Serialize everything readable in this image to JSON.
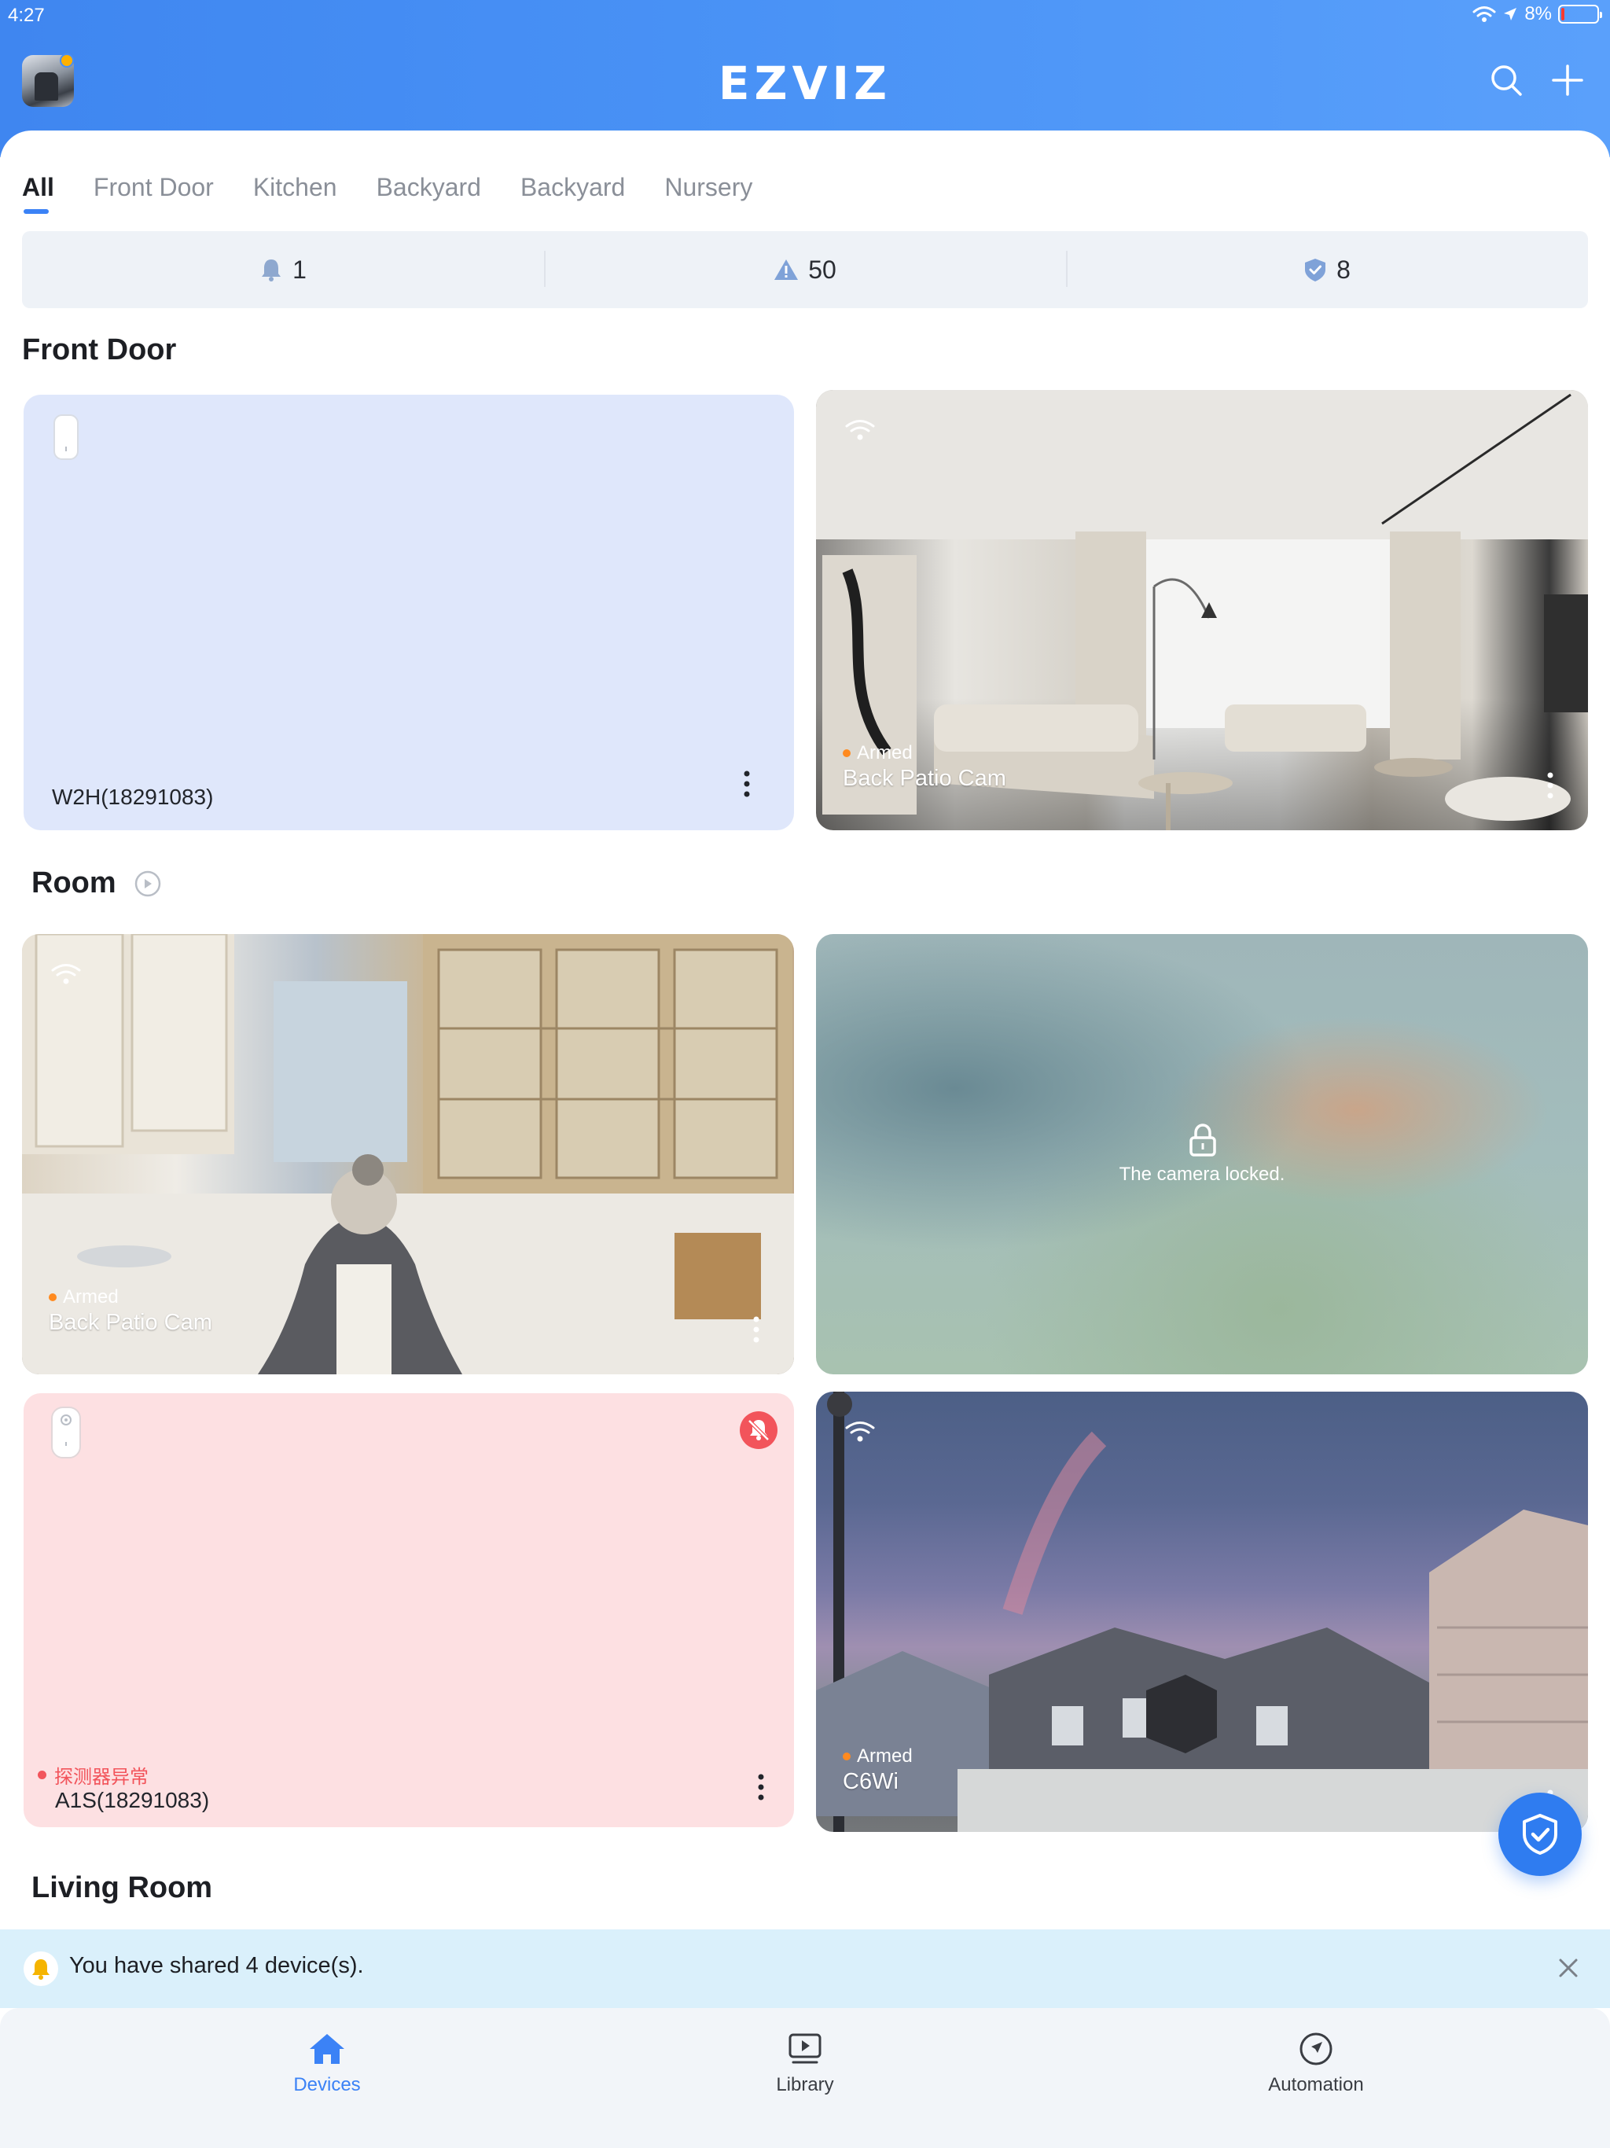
{
  "status_bar": {
    "time": "4:27",
    "battery": "8%"
  },
  "header": {
    "brand": "EZVIZ"
  },
  "tabs": [
    {
      "label": "All",
      "active": true
    },
    {
      "label": "Front Door",
      "active": false
    },
    {
      "label": "Kitchen",
      "active": false
    },
    {
      "label": "Backyard",
      "active": false
    },
    {
      "label": "Backyard",
      "active": false
    },
    {
      "label": "Nursery",
      "active": false
    }
  ],
  "summary": {
    "alerts": "1",
    "warnings": "50",
    "protected": "8"
  },
  "sections": {
    "front_door": "Front Door",
    "room": "Room",
    "living_room": "Living Room"
  },
  "cards": {
    "w2h": {
      "name": "W2H(18291083)"
    },
    "cam1": {
      "status": "Armed",
      "name": "Back Patio Cam"
    },
    "cam2": {
      "status": "Armed",
      "name": "Back Patio Cam"
    },
    "locked": {
      "message": "The camera locked."
    },
    "a1s": {
      "alert": "探测器异常",
      "name": "A1S(18291083)"
    },
    "c6wi": {
      "status": "Armed",
      "name": "C6Wi"
    }
  },
  "banner": {
    "text": "You have shared 4 device(s)."
  },
  "tabbar": [
    {
      "label": "Devices"
    },
    {
      "label": "Library"
    },
    {
      "label": "Automation"
    }
  ],
  "colors": {
    "accent": "#3b82f6",
    "header_start": "#3f86f0",
    "armed": "#ff8a1f",
    "alert_red": "#f2545b",
    "sensor_blue_card": "#dfe7fb",
    "sensor_pink_card": "#fde0e2",
    "banner_bg": "#daf0fb"
  }
}
